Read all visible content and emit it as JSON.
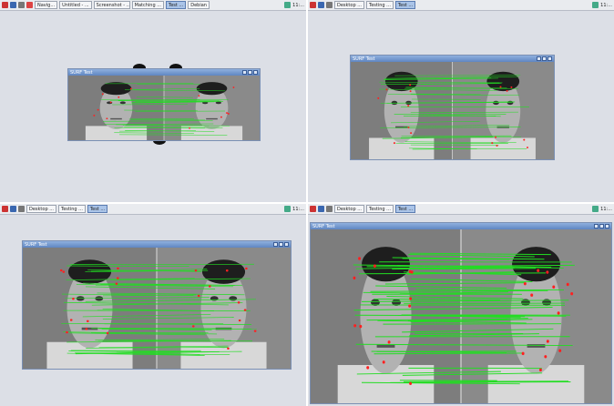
{
  "panels": [
    {
      "taskbar": {
        "tasks": [
          {
            "label": "Navig...",
            "active": false
          },
          {
            "label": "Untitled - ...",
            "active": false
          },
          {
            "label": "Screenshot - ...",
            "active": false
          },
          {
            "label": "Matching ...",
            "active": false
          },
          {
            "label": "Test ...",
            "active": true
          },
          {
            "label": "Debian",
            "active": false
          }
        ],
        "clock": "11:..."
      },
      "window": {
        "title": "SURF Test"
      }
    },
    {
      "taskbar": {
        "tasks": [
          {
            "label": "Desktop ...",
            "active": false
          },
          {
            "label": "Testing ...",
            "active": false
          },
          {
            "label": "Test ...",
            "active": true
          }
        ],
        "clock": "11:..."
      },
      "window": {
        "title": "SURF Test"
      }
    },
    {
      "taskbar": {
        "tasks": [
          {
            "label": "Desktop ...",
            "active": false
          },
          {
            "label": "Testing ...",
            "active": false
          },
          {
            "label": "Test ...",
            "active": true
          }
        ],
        "clock": "11:..."
      },
      "window": {
        "title": "SURF Test"
      }
    },
    {
      "taskbar": {
        "tasks": [
          {
            "label": "Desktop ...",
            "active": false
          },
          {
            "label": "Testing ...",
            "active": false
          },
          {
            "label": "Test ...",
            "active": true
          }
        ],
        "clock": "11:..."
      },
      "window": {
        "title": "SURF Test"
      }
    }
  ],
  "colors": {
    "match_line": "#22dd22",
    "keypoint": "#ff2020",
    "desktop": "#dcdfe6",
    "photo_bg": "#3a3a3a"
  }
}
